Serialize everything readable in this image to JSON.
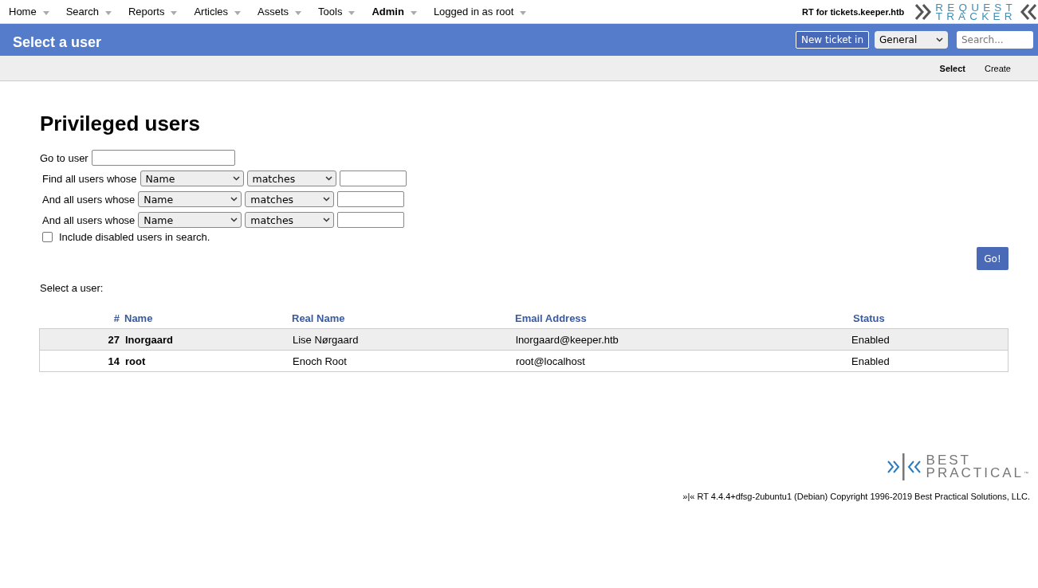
{
  "top_menu": [
    {
      "label": "Home",
      "selected": false
    },
    {
      "label": "Search",
      "selected": false
    },
    {
      "label": "Reports",
      "selected": false
    },
    {
      "label": "Articles",
      "selected": false
    },
    {
      "label": "Assets",
      "selected": false
    },
    {
      "label": "Tools",
      "selected": false
    },
    {
      "label": "Admin",
      "selected": true
    },
    {
      "label": "Logged in as root",
      "selected": false
    }
  ],
  "site_name": "RT for tickets.keeper.htb",
  "logo": {
    "line_1": "REQUEST",
    "line_2": "TRACKER"
  },
  "header": {
    "title": "Select a user",
    "new_ticket_button": "New ticket in",
    "queue_select": "General",
    "search": {
      "placeholder": "Search..."
    }
  },
  "page_menu": [
    {
      "label": "Select",
      "selected": true
    },
    {
      "label": "Create",
      "selected": false
    }
  ],
  "heading": "Privileged users",
  "go_to_user": {
    "label": "Go to user"
  },
  "criteria": [
    {
      "label": "Find all users whose",
      "field": "Name",
      "operator": "matches"
    },
    {
      "label": "And all users whose",
      "field": "Name",
      "operator": "matches"
    },
    {
      "label": "And all users whose",
      "field": "Name",
      "operator": "matches"
    }
  ],
  "include_disabled": {
    "label": "Include disabled users in search.",
    "checked": false
  },
  "go_button": "Go!",
  "select_label": "Select a user:",
  "table": {
    "columns": [
      "#",
      "Name",
      "Real Name",
      "Email Address",
      "Status"
    ],
    "rows": [
      {
        "id": "27",
        "name": "lnorgaard",
        "real_name": "Lise Nørgaard",
        "email": "lnorgaard@keeper.htb",
        "status": "Enabled"
      },
      {
        "id": "14",
        "name": "root",
        "real_name": "Enoch Root",
        "email": "root@localhost",
        "status": "Enabled"
      }
    ]
  },
  "footer": {
    "logo": {
      "line_1": "BEST",
      "line_2": "PRACTICAL",
      "mark": "™"
    },
    "copyright": "»|« RT 4.4.4+dfsg-2ubuntu1 (Debian) Copyright 1996-2019 Best Practical Solutions, LLC."
  }
}
